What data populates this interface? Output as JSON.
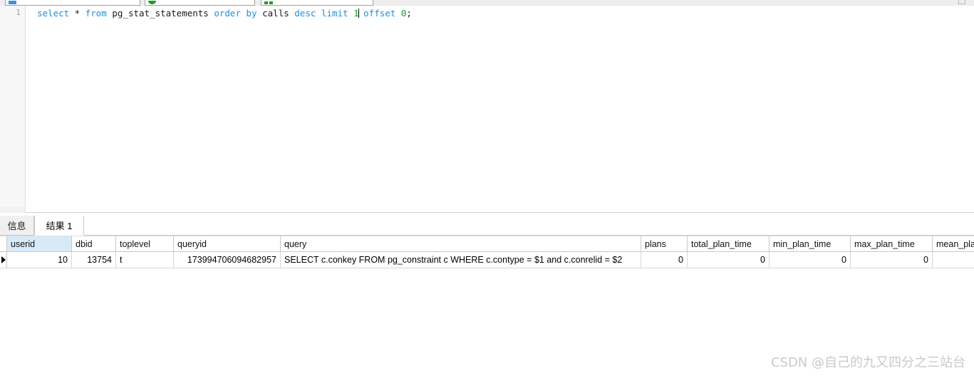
{
  "toolbar": {
    "boxes": [
      {
        "name": "connection-selector",
        "icon": "database-icon",
        "label": ""
      },
      {
        "name": "database-selector",
        "icon": "leaf-icon",
        "label": ""
      },
      {
        "name": "run-selector",
        "icon": "grid-icon",
        "label": ""
      }
    ]
  },
  "editor": {
    "line_number": "1",
    "tokens": [
      {
        "t": "select",
        "k": "kw"
      },
      {
        "t": " * ",
        "k": "pl"
      },
      {
        "t": "from",
        "k": "kw"
      },
      {
        "t": " pg_stat_statements ",
        "k": "pl"
      },
      {
        "t": "order",
        "k": "kw"
      },
      {
        "t": " ",
        "k": "pl"
      },
      {
        "t": "by",
        "k": "kw"
      },
      {
        "t": " calls ",
        "k": "pl"
      },
      {
        "t": "desc",
        "k": "kw"
      },
      {
        "t": " ",
        "k": "pl"
      },
      {
        "t": "limit",
        "k": "kw"
      },
      {
        "t": " ",
        "k": "pl"
      },
      {
        "t": "1",
        "k": "num"
      },
      {
        "t": "CARET",
        "k": "caret"
      },
      {
        "t": " ",
        "k": "pl"
      },
      {
        "t": "offset",
        "k": "kw"
      },
      {
        "t": " ",
        "k": "pl"
      },
      {
        "t": "0",
        "k": "num"
      },
      {
        "t": ";",
        "k": "pl"
      }
    ],
    "sql": "select * from pg_stat_statements order by calls desc limit 1 offset 0;"
  },
  "result_tabs": [
    {
      "label": "信息",
      "active": false
    },
    {
      "label": "结果 1",
      "active": true
    }
  ],
  "grid": {
    "columns": [
      {
        "label": "userid",
        "cls": "c0",
        "selected": true,
        "align": "right"
      },
      {
        "label": "dbid",
        "cls": "c1",
        "selected": false,
        "align": "right"
      },
      {
        "label": "toplevel",
        "cls": "c2",
        "selected": false,
        "align": "left"
      },
      {
        "label": "queryid",
        "cls": "c3",
        "selected": false,
        "align": "right"
      },
      {
        "label": "query",
        "cls": "c4",
        "selected": false,
        "align": "left"
      },
      {
        "label": "plans",
        "cls": "c5",
        "selected": false,
        "align": "right"
      },
      {
        "label": "total_plan_time",
        "cls": "c6",
        "selected": false,
        "align": "right"
      },
      {
        "label": "min_plan_time",
        "cls": "c7",
        "selected": false,
        "align": "right"
      },
      {
        "label": "max_plan_time",
        "cls": "c8",
        "selected": false,
        "align": "right"
      },
      {
        "label": "mean_plan_",
        "cls": "c9",
        "selected": false,
        "align": "left"
      }
    ],
    "rows": [
      {
        "marker": true,
        "cells": [
          "10",
          "13754",
          "t",
          "173994706094682957",
          "SELECT c.conkey FROM pg_constraint c WHERE c.contype = $1 and c.conrelid = $2",
          "0",
          "0",
          "0",
          "0",
          ""
        ]
      }
    ]
  },
  "watermark": {
    "text": "CSDN @自己的九又四分之三站台",
    "color": "#c9c9c9"
  },
  "colors": {
    "keyword": "#1f8fe0",
    "number": "#1aa01a",
    "header_selected_bg": "#d8eaf8",
    "toolbar_bg": "#eeeeee",
    "gutter_bg": "#f7f7f7"
  }
}
